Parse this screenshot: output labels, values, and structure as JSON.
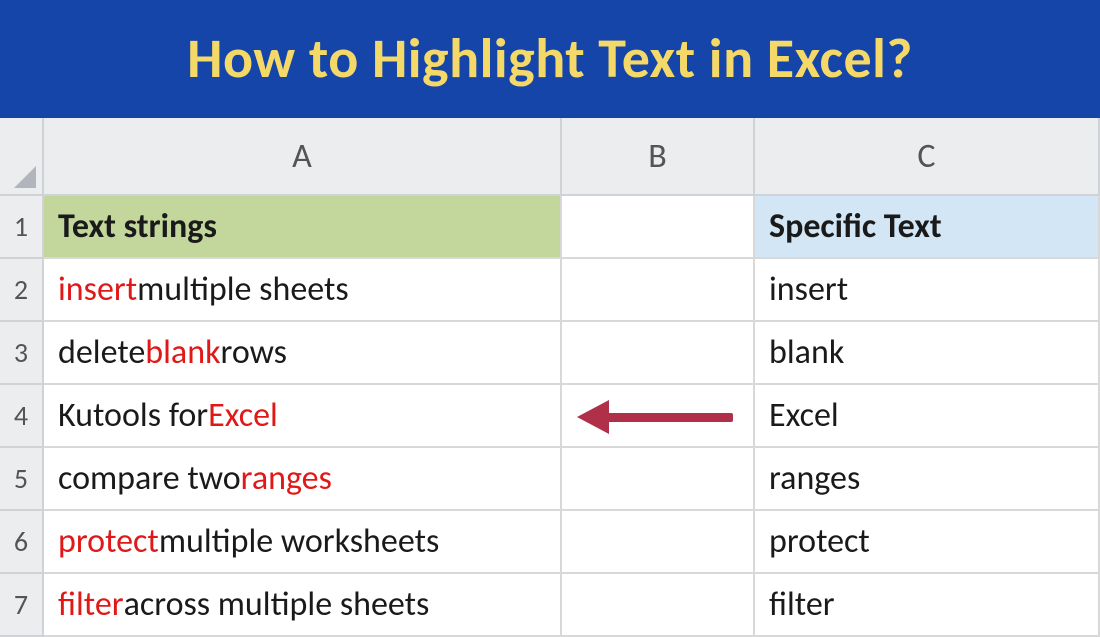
{
  "banner": {
    "title": "How to Highlight Text in Excel?"
  },
  "columns": {
    "a": "A",
    "b": "B",
    "c": "C"
  },
  "rowNums": [
    "1",
    "2",
    "3",
    "4",
    "5",
    "6",
    "7"
  ],
  "headers": {
    "a": "Text strings",
    "c": "Specific Text"
  },
  "rows": [
    {
      "pre": "",
      "hl": "insert",
      "post": " multiple sheets",
      "c": "insert"
    },
    {
      "pre": "delete ",
      "hl": "blank",
      "post": " rows",
      "c": "blank"
    },
    {
      "pre": "Kutools for ",
      "hl": "Excel",
      "post": "",
      "c": "Excel"
    },
    {
      "pre": "compare two ",
      "hl": "ranges",
      "post": "",
      "c": "ranges"
    },
    {
      "pre": "",
      "hl": "protect",
      "post": " multiple worksheets",
      "c": "protect"
    },
    {
      "pre": "",
      "hl": "filter",
      "post": " across multiple sheets",
      "c": "filter"
    }
  ]
}
